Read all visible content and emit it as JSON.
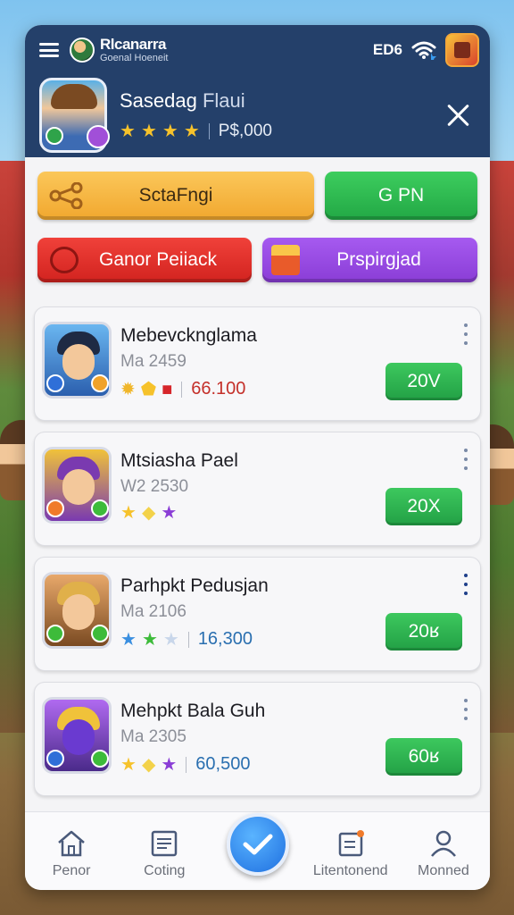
{
  "app": {
    "title": "Rlcanarra",
    "subtitle": "Goenal Hoeneit",
    "status_code": "ED6"
  },
  "profile": {
    "name": "Sasedag",
    "name_suffix": "Flaui",
    "stars": 4,
    "points": "P$,000"
  },
  "actions": {
    "share_label": "SctaFngi",
    "open_label": "G PN",
    "red_label": "Ganor Peiiack",
    "purple_label": "Prspirgjad"
  },
  "games": [
    {
      "title": "Mebevcknglama",
      "sub": "Ma 2459",
      "value": "66.100",
      "value_color": "#c4302a",
      "button": "20V",
      "gems": [
        "#f0b62a",
        "#f6c22b",
        "#d6252a"
      ]
    },
    {
      "title": "Mtsiasha Pael",
      "sub": "W2 2530",
      "value": "",
      "value_color": "#1c1c22",
      "button": "20X",
      "gems": [
        "#f6c22b",
        "#f3d24a",
        "#8a3dd6"
      ]
    },
    {
      "title": "Parhpkt Pedusjan",
      "sub": "Ma 2106",
      "value": "16,300",
      "value_color": "#2a6fb0",
      "button": "20ʁ",
      "gems": [
        "#3a8fe0",
        "#3dbb3a",
        "#c8d6ea"
      ]
    },
    {
      "title": "Mehpkt Bala Guh",
      "sub": "Ma 2305",
      "value": "60,500",
      "value_color": "#2a6fb0",
      "button": "60ʁ",
      "gems": [
        "#f6c22b",
        "#f3d24a",
        "#8a3dd6"
      ]
    }
  ],
  "nav": {
    "home": "Penor",
    "coting": "Coting",
    "leader": "Litentonend",
    "profile": "Monned"
  },
  "colors": {
    "header": "#24406a",
    "accent_green": "#22a845",
    "accent_blue": "#1e6fe0"
  }
}
